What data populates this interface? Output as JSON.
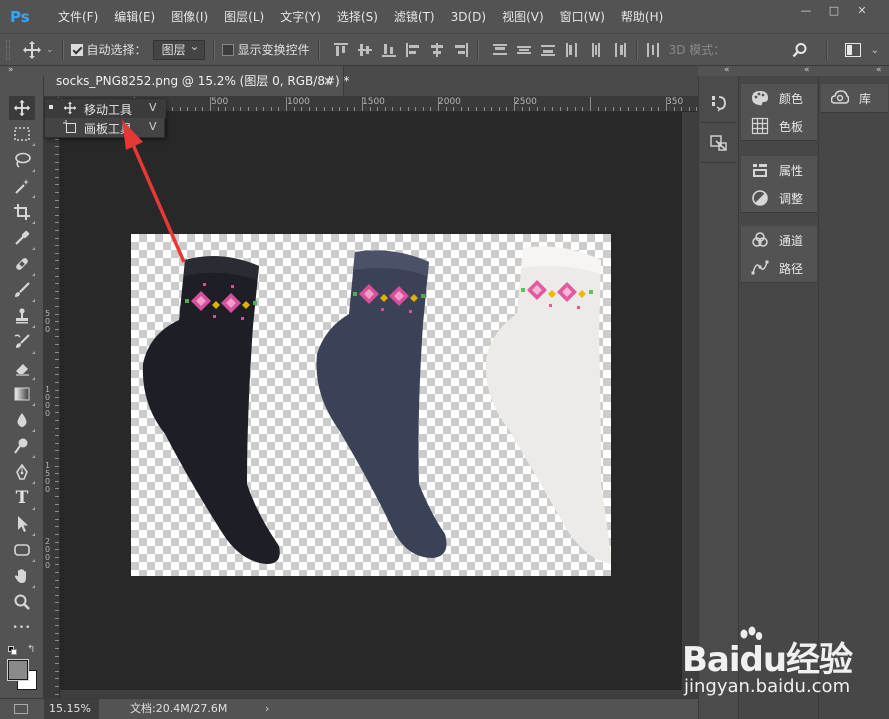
{
  "app": {
    "logo": "Ps"
  },
  "menu": [
    "文件(F)",
    "编辑(E)",
    "图像(I)",
    "图层(L)",
    "文字(Y)",
    "选择(S)",
    "滤镜(T)",
    "3D(D)",
    "视图(V)",
    "窗口(W)",
    "帮助(H)"
  ],
  "window_controls": {
    "minimize": "—",
    "restore": "□",
    "close": "✕"
  },
  "options": {
    "auto_select_label": "自动选择：",
    "auto_select_checked": true,
    "auto_select_value": "图层",
    "show_transform_label": "显示变换控件",
    "show_transform_checked": false,
    "mode_3d_label": "3D 模式："
  },
  "document": {
    "tab_title": "socks_PNG8252.png @ 15.2% (图层 0, RGB/8#) *",
    "close_glyph": "×"
  },
  "ruler": {
    "top_labels": [
      "500",
      "1000",
      "1500",
      "2000",
      "2500",
      "350"
    ],
    "left_labels": [
      "5",
      "0",
      "0",
      "1",
      "0",
      "0",
      "0",
      "1",
      "5",
      "0",
      "0",
      "2",
      "0",
      "0",
      "0"
    ]
  },
  "flyout": {
    "items": [
      {
        "label": "移动工具",
        "shortcut": "V",
        "selected": true,
        "icon": "move-icon"
      },
      {
        "label": "画板工具",
        "shortcut": "V",
        "selected": false,
        "icon": "artboard-icon"
      }
    ]
  },
  "tools": [
    "move-icon",
    "marquee-icon",
    "lasso-icon",
    "magic-wand-icon",
    "crop-icon",
    "eyedropper-icon",
    "healing-brush-icon",
    "brush-icon",
    "clone-stamp-icon",
    "history-brush-icon",
    "eraser-icon",
    "gradient-icon",
    "blur-icon",
    "dodge-icon",
    "pen-icon",
    "type-icon",
    "path-selection-icon",
    "shape-icon",
    "hand-icon",
    "zoom-icon",
    "more-tools-icon"
  ],
  "tool_type_glyph": "T",
  "tool_more_glyph": "•••",
  "status": {
    "zoom": "15.15%",
    "doc_info": "文档:20.4M/27.6M",
    "arrow": "›"
  },
  "panels": {
    "group1": [
      {
        "label": "颜色",
        "icon": "palette-icon"
      },
      {
        "label": "色板",
        "icon": "swatches-icon"
      }
    ],
    "group2": [
      {
        "label": "属性",
        "icon": "properties-icon"
      },
      {
        "label": "调整",
        "icon": "adjustments-icon"
      }
    ],
    "group3": [
      {
        "label": "通道",
        "icon": "channels-icon"
      },
      {
        "label": "路径",
        "icon": "paths-icon"
      }
    ],
    "libraries": {
      "label": "库",
      "icon": "cc-libraries-icon"
    }
  },
  "watermark": {
    "logo": "Baidu经验",
    "url": "jingyan.baidu.com"
  },
  "colors": {
    "ui_bg": "#535353",
    "canvas_bg": "#282828",
    "annotation_arrow": "#e53935",
    "sock_black": "#1e1f26",
    "sock_navy": "#3b4257",
    "sock_white": "#ecebe8"
  }
}
